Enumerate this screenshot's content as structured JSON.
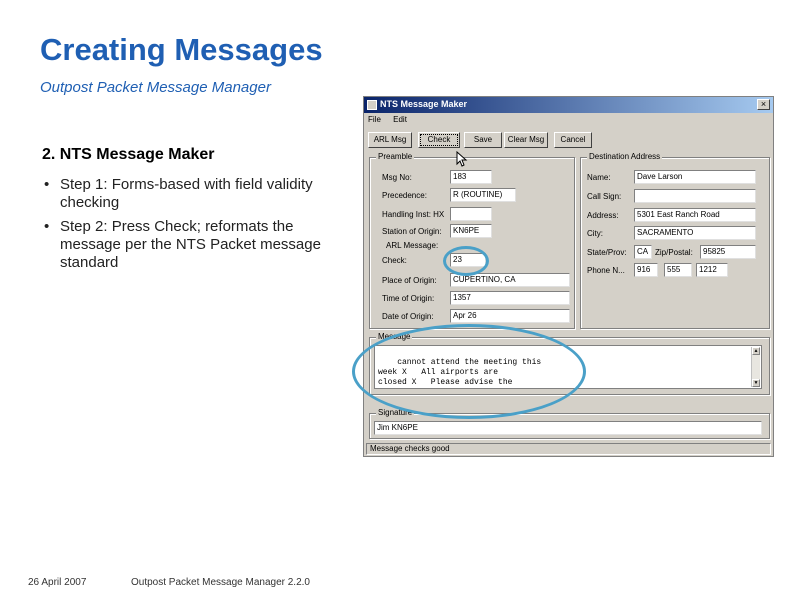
{
  "slide": {
    "title": "Creating Messages",
    "subtitle": "Outpost Packet Message Manager",
    "section_heading": "2. NTS Message Maker",
    "bullets": [
      "Step 1: Forms-based with field validity checking",
      "Step 2: Press Check; reformats the message per the NTS Packet message standard"
    ],
    "bullet_symbol": "•",
    "footer_date": "26 April 2007",
    "footer_app": "Outpost Packet Message Manager 2.2.0",
    "title_color": "#1f5fb3",
    "annotation_color": "#4aa0c8"
  },
  "window": {
    "title": "NTS Message Maker",
    "close_glyph": "×",
    "menu": [
      "File",
      "Edit"
    ],
    "buttons": {
      "arl_msg": "ARL Msg",
      "check": "Check",
      "save": "Save",
      "clear_msg": "Clear Msg",
      "cancel": "Cancel"
    },
    "preamble": {
      "label": "Preamble",
      "msg_no_label": "Msg No:",
      "msg_no": "183",
      "precedence_label": "Precedence:",
      "precedence": "R (ROUTINE)",
      "handling_label": "Handling Inst: HX",
      "handling": "",
      "station_label": "Station of Origin:",
      "station": "KN6PE",
      "arl_label": "ARL Message:",
      "check_label": "Check:",
      "check": "23",
      "place_label": "Place of Origin:",
      "place": "CUPERTINO, CA",
      "time_label": "Time of Origin:",
      "time": "1357",
      "date_label": "Date of Origin:",
      "date": "Apr 26"
    },
    "destination": {
      "label": "Destination Address",
      "name_label": "Name:",
      "name": "Dave Larson",
      "callsign_label": "Call Sign:",
      "callsign": "",
      "address_label": "Address:",
      "address": "5301 East Ranch Road",
      "city_label": "City:",
      "city": "SACRAMENTO",
      "state_label": "State/Prov:",
      "state": "CA",
      "zip_label": "Zip/Postal:",
      "zip": "95825",
      "phone_label": "Phone N...",
      "phone_area": "916",
      "phone_prefix": "555",
      "phone_line": "1212"
    },
    "message": {
      "label": "Message",
      "text": "cannot attend the meeting this\nweek X   All airports are\nclosed X   Please advise the\nrepeater committee that the project"
    },
    "signature": {
      "label": "Signature",
      "value": "Jim KN6PE"
    },
    "status": "Message checks good"
  }
}
